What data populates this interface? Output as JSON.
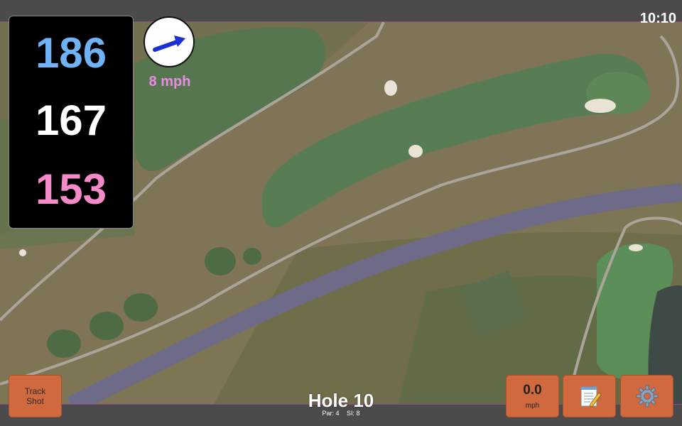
{
  "status": {
    "time": "10:10"
  },
  "distances": {
    "back": "186",
    "middle": "167",
    "front": "153"
  },
  "wind": {
    "speed_label": "8 mph",
    "icon": "wind-direction-arrow-icon"
  },
  "controls": {
    "track_shot_line1": "Track",
    "track_shot_line2": "Shot",
    "speed_value": "0.0",
    "speed_unit": "mph",
    "notes_icon": "notepad-icon",
    "settings_icon": "gear-icon"
  },
  "hole": {
    "title": "Hole 10",
    "par": "Par: 4",
    "si": "SI: 8"
  },
  "colors": {
    "back_distance": "#6fb2f5",
    "middle_distance": "#ffffff",
    "front_distance": "#f58ac8",
    "wind_label": "#e98ce2",
    "button": "#d06a3e"
  }
}
